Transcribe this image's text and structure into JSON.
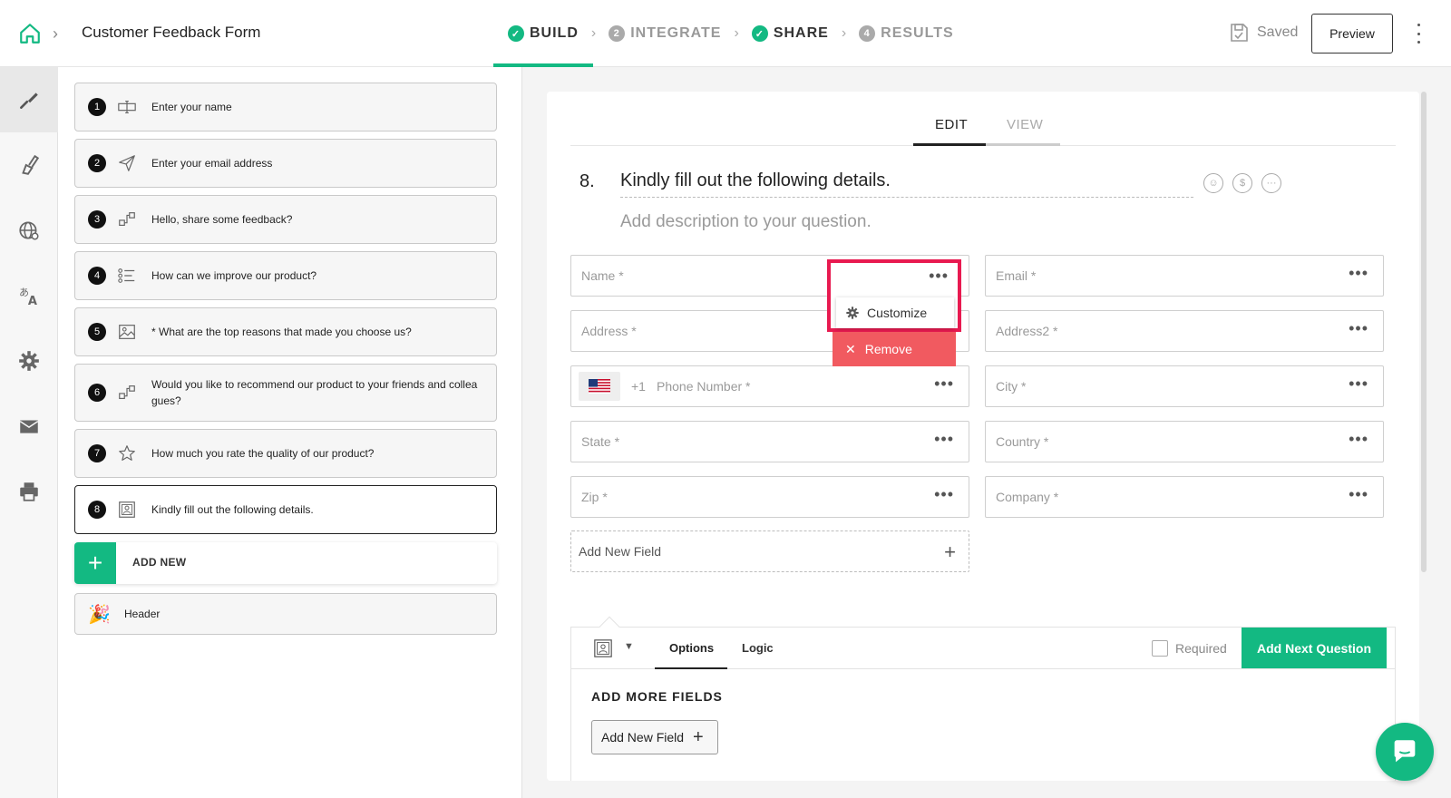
{
  "header": {
    "form_title": "Customer Feedback Form",
    "steps": [
      {
        "label": "BUILD",
        "marker": "✓",
        "state": "done"
      },
      {
        "label": "INTEGRATE",
        "marker": "2",
        "state": "todo"
      },
      {
        "label": "SHARE",
        "marker": "✓",
        "state": "done"
      },
      {
        "label": "RESULTS",
        "marker": "4",
        "state": "todo"
      }
    ],
    "saved_label": "Saved",
    "preview_label": "Preview"
  },
  "rail": {
    "icons": [
      "brush-icon",
      "theme-brush-icon",
      "globe-icon",
      "translate-icon",
      "gear-icon",
      "mail-icon",
      "print-icon"
    ]
  },
  "questions": [
    {
      "num": "1",
      "text": "Enter your name",
      "icon": "text-input-icon"
    },
    {
      "num": "2",
      "text": "Enter your email address",
      "icon": "send-icon"
    },
    {
      "num": "3",
      "text": "Hello, share some feedback?",
      "icon": "flow-icon"
    },
    {
      "num": "4",
      "text": "How can we improve our product?",
      "icon": "list-icon"
    },
    {
      "num": "5",
      "text": "* What are the top reasons that made you choose us?",
      "icon": "image-icon"
    },
    {
      "num": "6",
      "text": "Would you like to recommend our product to your friends and collea gues?",
      "icon": "flow-icon"
    },
    {
      "num": "7",
      "text": "How much you rate the quality of our product?",
      "icon": "star-icon"
    },
    {
      "num": "8",
      "text": "Kindly fill out the following details.",
      "icon": "contact-card-icon"
    }
  ],
  "add_new_label": "ADD NEW",
  "header_item_label": "Header",
  "editor": {
    "tab_edit": "EDIT",
    "tab_view": "VIEW",
    "question_number": "8.",
    "question_title": "Kindly fill out the following details.",
    "question_desc": "Add description to your question.",
    "fields": {
      "name": "Name *",
      "email": "Email *",
      "address": "Address *",
      "address2": "Address2 *",
      "dial_code": "+1",
      "phone": "Phone Number *",
      "city": "City *",
      "state": "State *",
      "country": "Country *",
      "zip": "Zip *",
      "company": "Company *"
    },
    "add_field_label": "Add New Field",
    "menu": {
      "customize": "Customize",
      "remove": "Remove"
    }
  },
  "bottom": {
    "tab_options": "Options",
    "tab_logic": "Logic",
    "required_label": "Required",
    "next_button": "Add Next Question",
    "section_heading": "ADD MORE FIELDS",
    "add_field_button": "Add New Field"
  },
  "colors": {
    "accent": "#13b982",
    "highlight": "#e81a50",
    "remove": "#f15a60"
  }
}
